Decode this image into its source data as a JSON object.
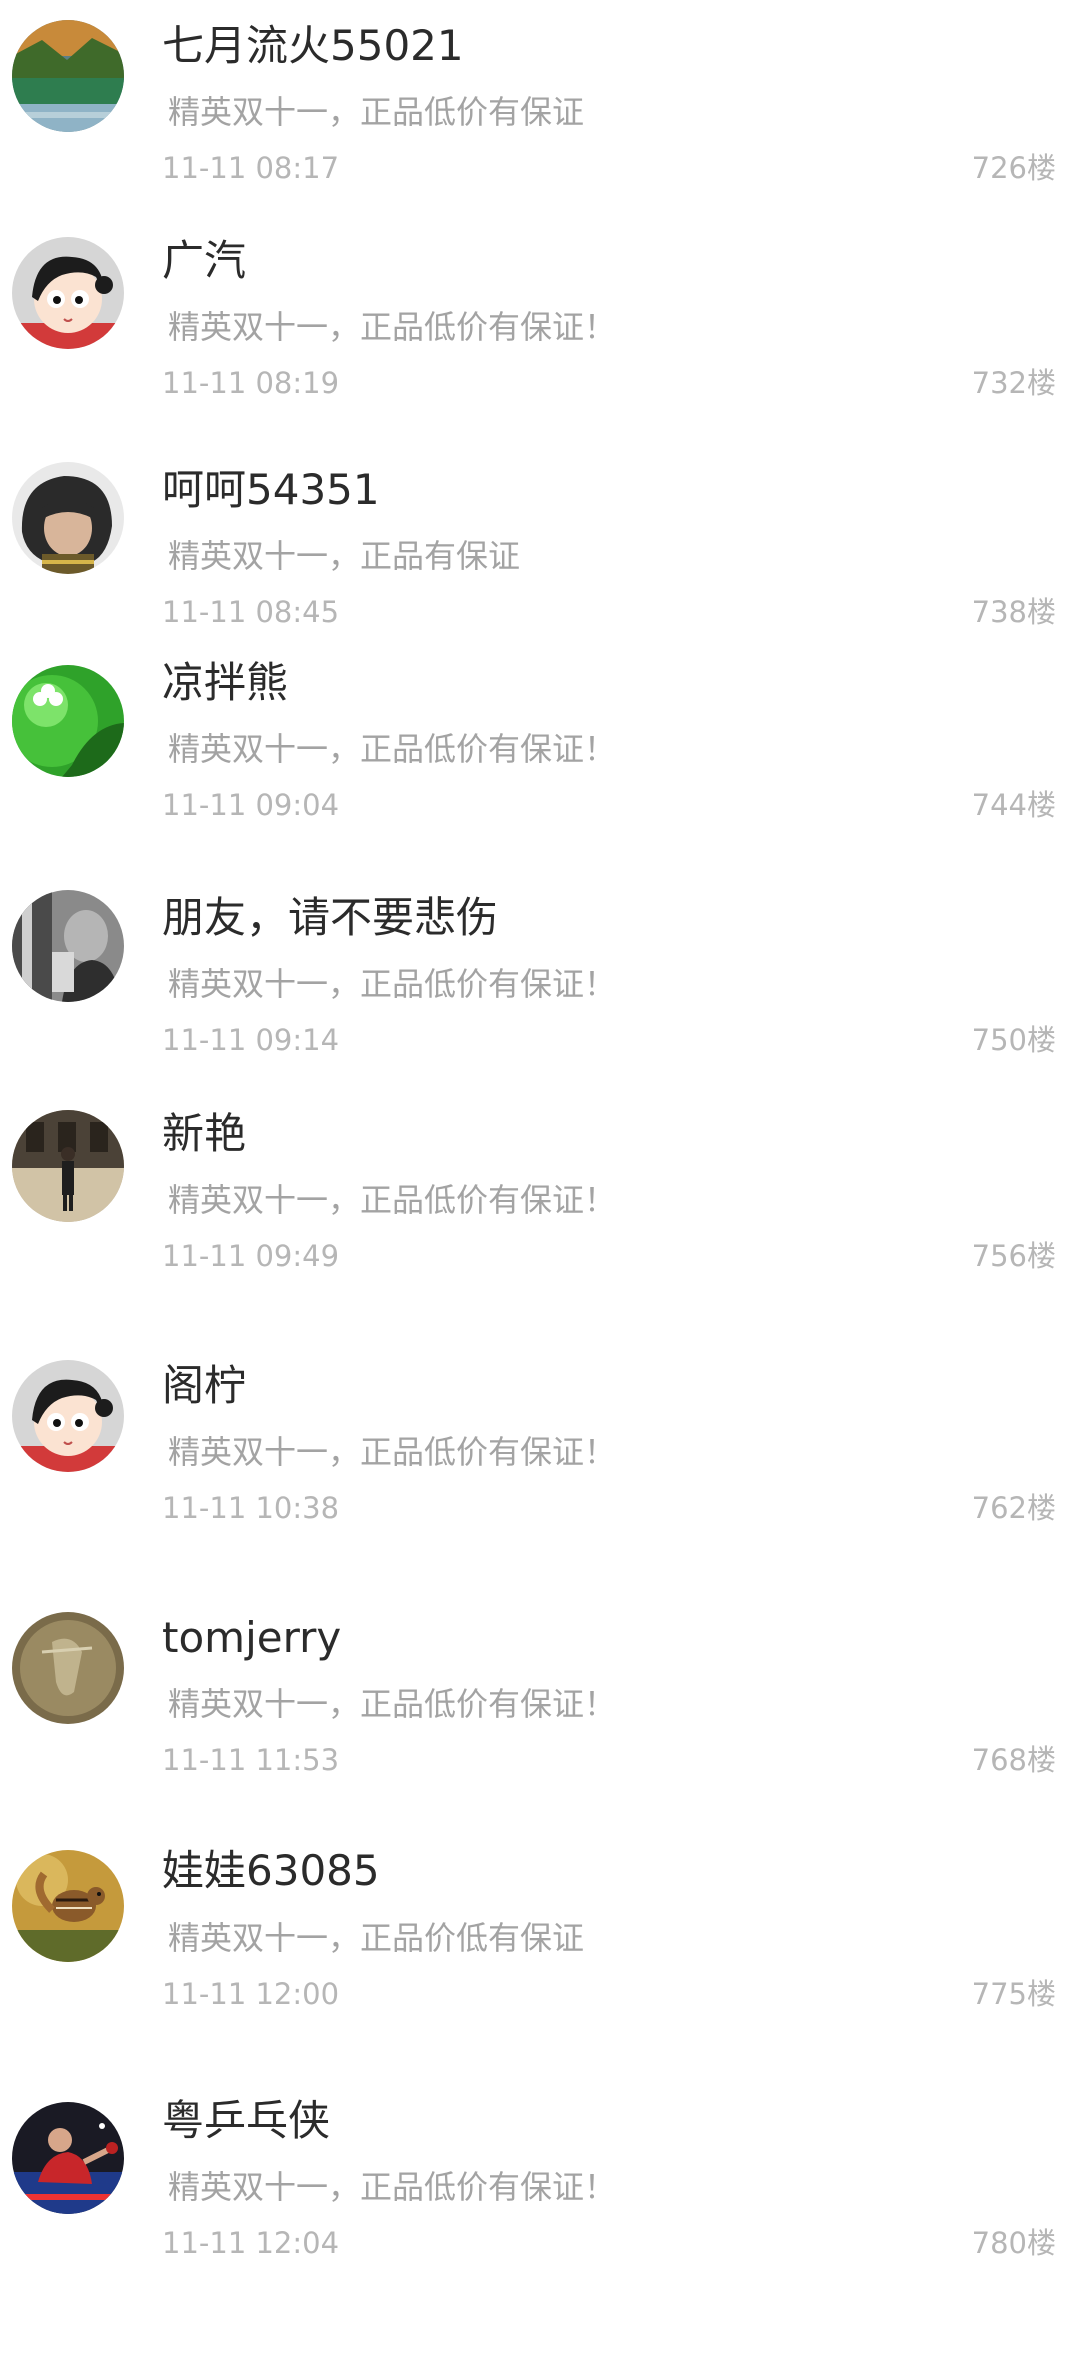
{
  "comments": [
    {
      "avatar": "landscape-avatar-icon",
      "username": "七月流火55021",
      "content": "精英双十一，正品低价有保证",
      "time": "11-11 08:17",
      "floor": "726楼"
    },
    {
      "avatar": "cartoon-girl-avatar-icon",
      "username": "广汽",
      "content": "精英双十一，正品低价有保证！",
      "time": "11-11 08:19",
      "floor": "732楼"
    },
    {
      "avatar": "child-photo-avatar-icon",
      "username": "呵呵54351",
      "content": "精英双十一，正品有保证",
      "time": "11-11 08:45",
      "floor": "738楼"
    },
    {
      "avatar": "green-clover-avatar-icon",
      "username": "凉拌熊",
      "content": "精英双十一，正品低价有保证！",
      "time": "11-11 09:04",
      "floor": "744楼"
    },
    {
      "avatar": "bw-photo-avatar-icon",
      "username": "朋友，请不要悲伤",
      "content": "精英双十一，正品低价有保证！",
      "time": "11-11 09:14",
      "floor": "750楼"
    },
    {
      "avatar": "building-photo-avatar-icon",
      "username": "新艳",
      "content": "精英双十一，正品低价有保证！",
      "time": "11-11 09:49",
      "floor": "756楼"
    },
    {
      "avatar": "cartoon-girl-avatar-icon",
      "username": "阁柠",
      "content": "精英双十一，正品低价有保证！",
      "time": "11-11 10:38",
      "floor": "762楼"
    },
    {
      "avatar": "sepia-photo-avatar-icon",
      "username": "tomjerry",
      "content": "精英双十一，正品低价有保证！",
      "time": "11-11 11:53",
      "floor": "768楼"
    },
    {
      "avatar": "squirrel-photo-avatar-icon",
      "username": "娃娃63085",
      "content": "精英双十一，正品价低有保证",
      "time": "11-11 12:00",
      "floor": "775楼"
    },
    {
      "avatar": "pingpong-photo-avatar-icon",
      "username": "粤乒乓侠",
      "content": "精英双十一，正品低价有保证！",
      "time": "11-11 12:04",
      "floor": "780楼"
    }
  ]
}
